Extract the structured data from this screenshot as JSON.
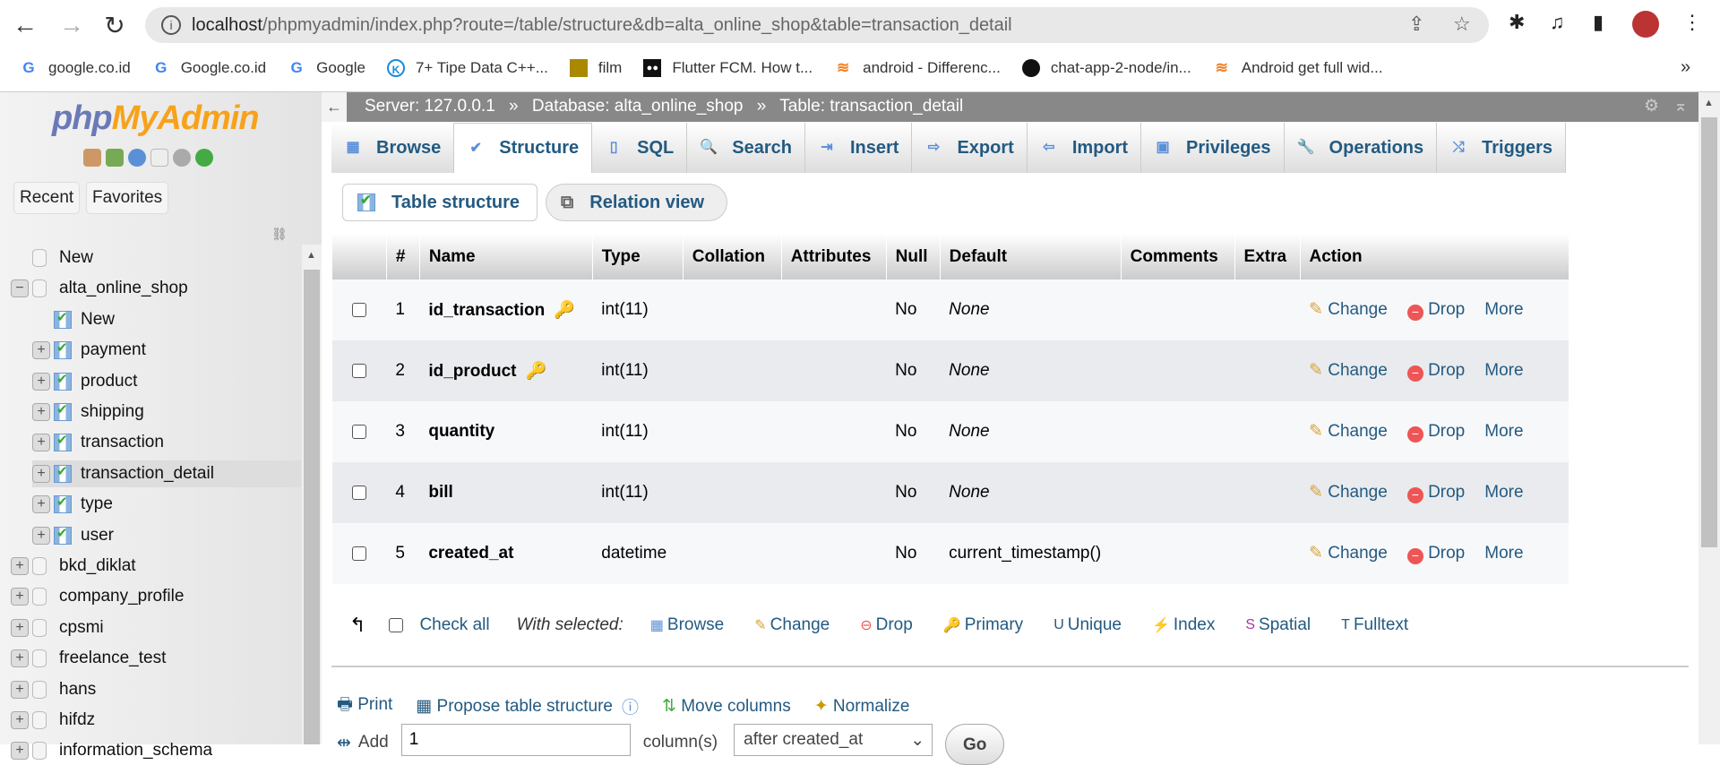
{
  "browser": {
    "url_host": "localhost",
    "url_path": "/phpmyadmin/index.php?route=/table/structure&db=alta_online_shop&table=transaction_detail",
    "bookmarks": [
      "google.co.id",
      "Google.co.id",
      "Google",
      "7+ Tipe Data C++...",
      "film",
      "Flutter FCM. How t...",
      "android - Differenc...",
      "chat-app-2-node/in...",
      "Android get full wid..."
    ],
    "more": "»"
  },
  "sidebar": {
    "logo": "phpMyAdmin",
    "recent": "Recent",
    "favorites": "Favorites",
    "tree": [
      {
        "label": "New",
        "level": 0,
        "kind": "newdb"
      },
      {
        "label": "alta_online_shop",
        "level": 0,
        "kind": "db",
        "expanded": true
      },
      {
        "label": "New",
        "level": 1,
        "kind": "newtable"
      },
      {
        "label": "payment",
        "level": 1,
        "kind": "table"
      },
      {
        "label": "product",
        "level": 1,
        "kind": "table"
      },
      {
        "label": "shipping",
        "level": 1,
        "kind": "table"
      },
      {
        "label": "transaction",
        "level": 1,
        "kind": "table"
      },
      {
        "label": "transaction_detail",
        "level": 1,
        "kind": "table",
        "selected": true
      },
      {
        "label": "type",
        "level": 1,
        "kind": "table"
      },
      {
        "label": "user",
        "level": 1,
        "kind": "table"
      },
      {
        "label": "bkd_diklat",
        "level": 0,
        "kind": "db"
      },
      {
        "label": "company_profile",
        "level": 0,
        "kind": "db"
      },
      {
        "label": "cpsmi",
        "level": 0,
        "kind": "db"
      },
      {
        "label": "freelance_test",
        "level": 0,
        "kind": "db"
      },
      {
        "label": "hans",
        "level": 0,
        "kind": "db"
      },
      {
        "label": "hifdz",
        "level": 0,
        "kind": "db"
      },
      {
        "label": "information_schema",
        "level": 0,
        "kind": "db"
      }
    ]
  },
  "breadcrumb": {
    "server": "Server: 127.0.0.1",
    "database": "Database: alta_online_shop",
    "table": "Table: transaction_detail",
    "sep": "»"
  },
  "tabs": [
    "Browse",
    "Structure",
    "SQL",
    "Search",
    "Insert",
    "Export",
    "Import",
    "Privileges",
    "Operations",
    "Triggers"
  ],
  "active_tab": "Structure",
  "subtabs": {
    "structure": "Table structure",
    "relation": "Relation view"
  },
  "table": {
    "headers": [
      "#",
      "Name",
      "Type",
      "Collation",
      "Attributes",
      "Null",
      "Default",
      "Comments",
      "Extra",
      "Action"
    ],
    "rows": [
      {
        "num": "1",
        "name": "id_transaction",
        "key": true,
        "type": "int(11)",
        "null": "No",
        "default": "None",
        "default_italic": true
      },
      {
        "num": "2",
        "name": "id_product",
        "key": true,
        "type": "int(11)",
        "null": "No",
        "default": "None",
        "default_italic": true
      },
      {
        "num": "3",
        "name": "quantity",
        "key": false,
        "type": "int(11)",
        "null": "No",
        "default": "None",
        "default_italic": true
      },
      {
        "num": "4",
        "name": "bill",
        "key": false,
        "type": "int(11)",
        "null": "No",
        "default": "None",
        "default_italic": true
      },
      {
        "num": "5",
        "name": "created_at",
        "key": false,
        "type": "datetime",
        "null": "No",
        "default": "current_timestamp()",
        "default_italic": false
      }
    ],
    "actions": {
      "change": "Change",
      "drop": "Drop",
      "more": "More"
    }
  },
  "bulk": {
    "check_all": "Check all",
    "with_selected": "With selected:",
    "items": [
      "Browse",
      "Change",
      "Drop",
      "Primary",
      "Unique",
      "Index",
      "Spatial",
      "Fulltext"
    ]
  },
  "tools": {
    "print": "Print",
    "propose": "Propose table structure",
    "move": "Move columns",
    "normalize": "Normalize"
  },
  "add": {
    "label": "Add",
    "count": "1",
    "unit": "column(s)",
    "position": "after created_at",
    "go": "Go"
  }
}
